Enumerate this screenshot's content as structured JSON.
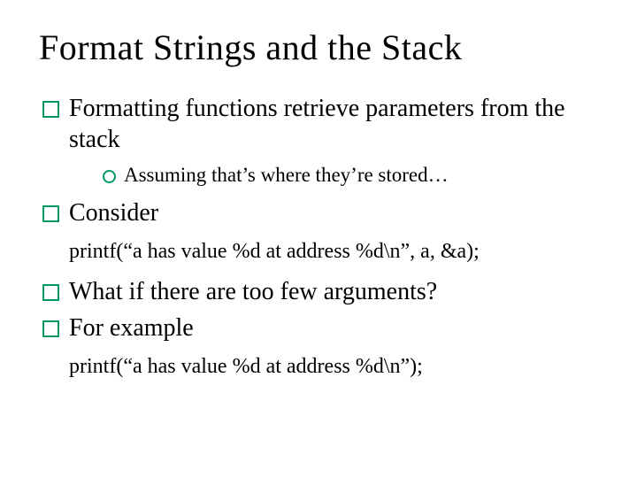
{
  "title": "Format Strings and the Stack",
  "bullets": {
    "b1": "Formatting functions retrieve parameters from the stack",
    "b1_sub": "Assuming that’s where they’re stored…",
    "b2": "Consider",
    "code1": "printf(“a has value %d at address %d\\n”, a, &a);",
    "b3": "What if there are too few arguments?",
    "b4": "For example",
    "code2": "printf(“a has value %d at address %d\\n”);"
  }
}
